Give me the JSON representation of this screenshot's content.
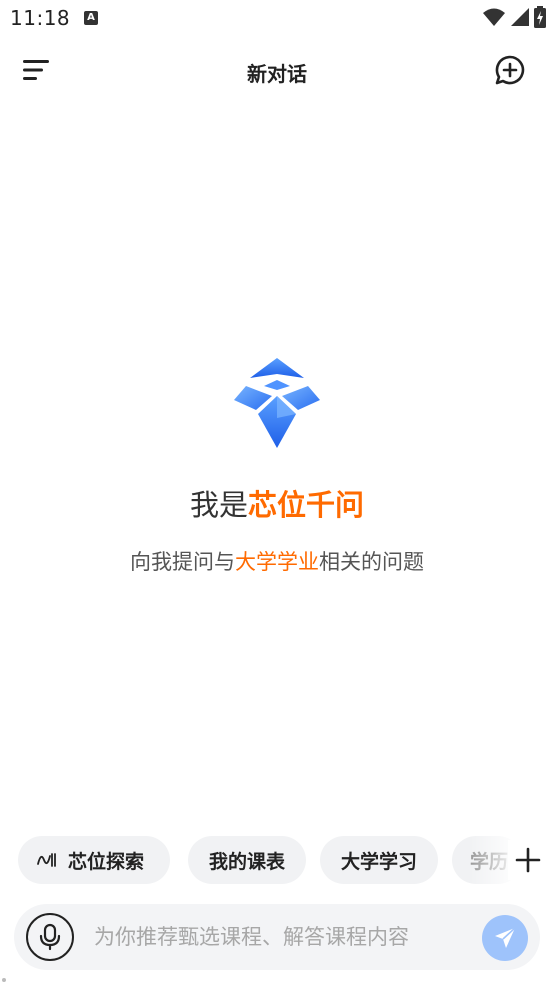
{
  "status_bar": {
    "time": "11:18",
    "a_badge": "A",
    "icons": [
      "a-badge-icon",
      "wifi-icon",
      "signal-icon",
      "battery-icon"
    ]
  },
  "header": {
    "title": "新对话",
    "icons": [
      "menu-icon",
      "new-chat-icon"
    ]
  },
  "hero": {
    "title_prefix": "我是",
    "title_accent": "芯位千问",
    "subtitle_prefix": "向我提问与",
    "subtitle_accent": "大学学业",
    "subtitle_suffix": "相关的问题",
    "logo_icon": "kite-logo-icon"
  },
  "chips": [
    {
      "label": "芯位探索",
      "icon": "explore-wave-icon"
    },
    {
      "label": "我的课表"
    },
    {
      "label": "大学学习"
    },
    {
      "label": "学历"
    }
  ],
  "chips_more_icon": "plus-icon",
  "input": {
    "placeholder": "为你推荐甄选课程、解答课程内容",
    "value": "",
    "mic_icon": "microphone-icon",
    "send_icon": "send-icon"
  },
  "colors": {
    "accent": "#ff6a00",
    "brand_blue": "#2f7bf5",
    "send_button": "#9ec3fb",
    "chip_bg": "#f1f2f4",
    "input_bg": "#f3f4f6"
  }
}
